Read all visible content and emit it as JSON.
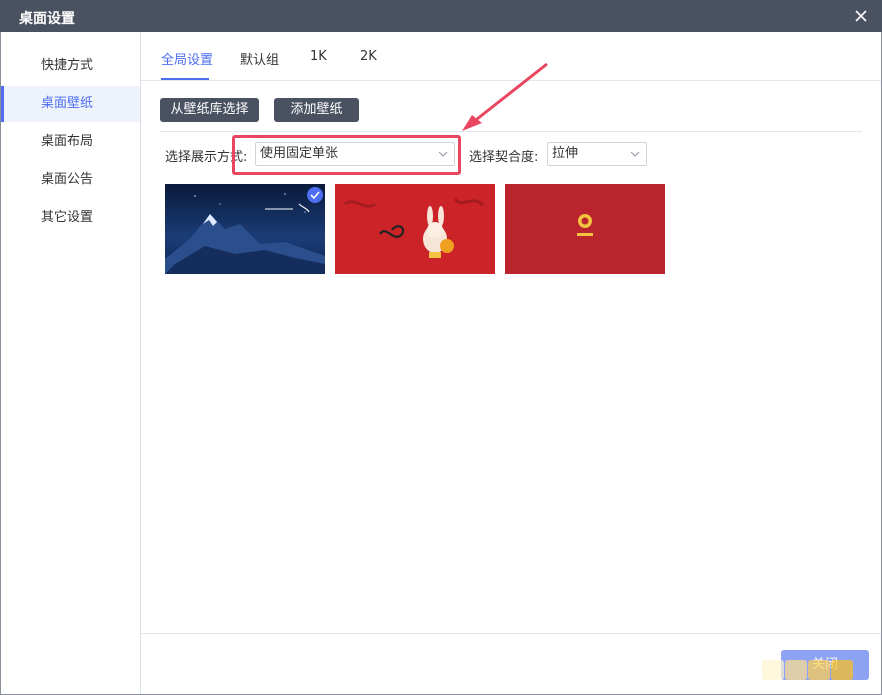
{
  "window": {
    "title": "桌面设置"
  },
  "sidebar": {
    "items": [
      {
        "label": "快捷方式",
        "active": false
      },
      {
        "label": "桌面壁纸",
        "active": true
      },
      {
        "label": "桌面布局",
        "active": false
      },
      {
        "label": "桌面公告",
        "active": false
      },
      {
        "label": "其它设置",
        "active": false
      }
    ]
  },
  "tabs": [
    {
      "label": "全局设置",
      "active": true
    },
    {
      "label": "默认组",
      "active": false
    },
    {
      "label": "1K",
      "active": false
    },
    {
      "label": "2K",
      "active": false
    }
  ],
  "actions": {
    "choose_from_library": "从壁纸库选择",
    "add_wallpaper": "添加壁纸"
  },
  "display_mode": {
    "label": "选择展示方式:",
    "value": "使用固定单张"
  },
  "fit_mode": {
    "label": "选择契合度:",
    "value": "拉伸"
  },
  "wallpapers": [
    {
      "name": "snowy-mountain-night",
      "selected": true
    },
    {
      "name": "rabbit-new-year-red",
      "selected": false
    },
    {
      "name": "red-plain-logo",
      "selected": false
    }
  ],
  "footer": {
    "close_label": "关闭"
  },
  "watermark": {
    "text": "网吧三国"
  },
  "colors": {
    "titlebar": "#4a5161",
    "accent": "#4e6ef2",
    "highlight": "#e8475f"
  }
}
